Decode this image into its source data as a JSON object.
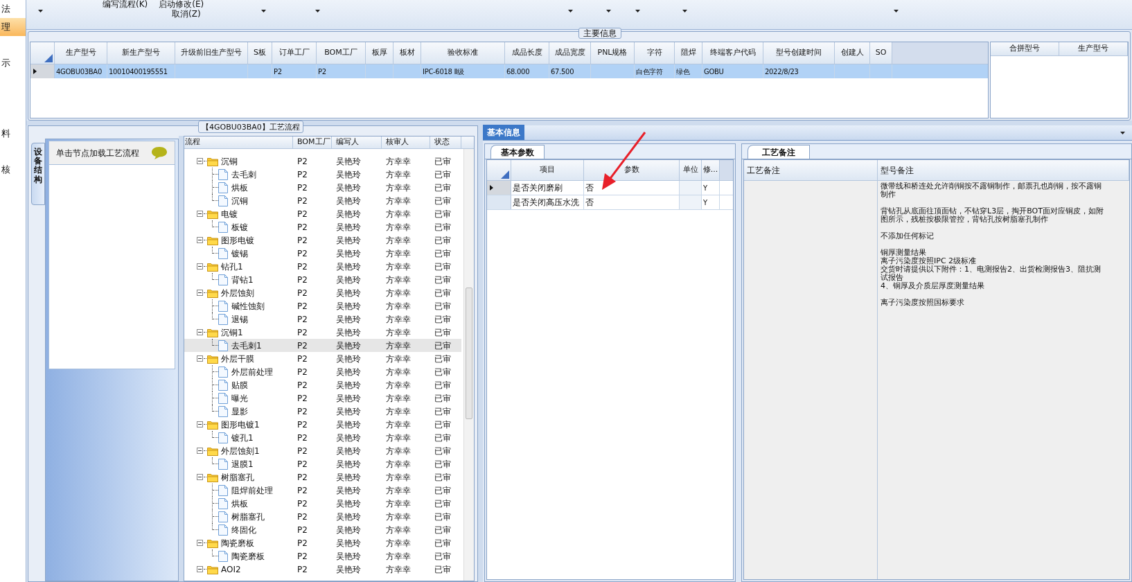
{
  "sidebar": {
    "items": [
      {
        "label": "法",
        "selected": false
      },
      {
        "label": "理",
        "selected": true
      },
      {
        "label": "示",
        "selected": false
      },
      {
        "label": "料",
        "selected": false
      },
      {
        "label": "核",
        "selected": false
      }
    ]
  },
  "ribbon": {
    "commands": [
      "编写流程(K)",
      "启动修改(E)",
      "取消(Z)"
    ]
  },
  "main_info": {
    "title": "主要信息",
    "columns": [
      "生产型号",
      "新生产型号",
      "升级前旧生产型号",
      "S板",
      "订单工厂",
      "BOM工厂",
      "板厚",
      "板材",
      "验收标准",
      "成品长度",
      "成品宽度",
      "PNL规格",
      "字符",
      "阻焊",
      "终端客户代码",
      "型号创建时间",
      "创建人",
      "SO"
    ],
    "rows": [
      {
        "selected": true,
        "cells": [
          "4GOBU03BA0",
          "10010400195551",
          "",
          "",
          "P2",
          "P2",
          "",
          "",
          "IPC-6018 Ⅱ级",
          "68.000",
          "67.500",
          "",
          "白色字符",
          "绿色",
          "GOBU",
          "2022/8/23",
          "",
          ""
        ]
      }
    ],
    "merge_columns": [
      "合拼型号",
      "生产型号"
    ]
  },
  "flow": {
    "title": "【4GOBU03BA0】工艺流程",
    "side_tab": "设备结构",
    "hint": "单击节点加载工艺流程",
    "columns": [
      "流程",
      "BOM工厂",
      "编写人",
      "核审人",
      "状态"
    ],
    "tree": [
      {
        "name": "沉铜",
        "bom": "P2",
        "writer": "吴艳玲",
        "reviewer": "方幸幸",
        "status": "已审",
        "selected": false,
        "expanded": true,
        "children": [
          {
            "name": "去毛刺",
            "bom": "P2",
            "writer": "吴艳玲",
            "reviewer": "方幸幸",
            "status": "已审",
            "selected": false
          },
          {
            "name": "烘板",
            "bom": "P2",
            "writer": "吴艳玲",
            "reviewer": "方幸幸",
            "status": "已审",
            "selected": false
          },
          {
            "name": "沉铜",
            "bom": "P2",
            "writer": "吴艳玲",
            "reviewer": "方幸幸",
            "status": "已审",
            "selected": false
          }
        ]
      },
      {
        "name": "电镀",
        "bom": "P2",
        "writer": "吴艳玲",
        "reviewer": "方幸幸",
        "status": "已审",
        "selected": false,
        "expanded": true,
        "children": [
          {
            "name": "板镀",
            "bom": "P2",
            "writer": "吴艳玲",
            "reviewer": "方幸幸",
            "status": "已审",
            "selected": false
          }
        ]
      },
      {
        "name": "图形电镀",
        "bom": "P2",
        "writer": "吴艳玲",
        "reviewer": "方幸幸",
        "status": "已审",
        "selected": false,
        "expanded": true,
        "children": [
          {
            "name": "镀锡",
            "bom": "P2",
            "writer": "吴艳玲",
            "reviewer": "方幸幸",
            "status": "已审",
            "selected": false
          }
        ]
      },
      {
        "name": "钻孔1",
        "bom": "P2",
        "writer": "吴艳玲",
        "reviewer": "方幸幸",
        "status": "已审",
        "selected": false,
        "expanded": true,
        "children": [
          {
            "name": "背钻1",
            "bom": "P2",
            "writer": "吴艳玲",
            "reviewer": "方幸幸",
            "status": "已审",
            "selected": false
          }
        ]
      },
      {
        "name": "外层蚀刻",
        "bom": "P2",
        "writer": "吴艳玲",
        "reviewer": "方幸幸",
        "status": "已审",
        "selected": false,
        "expanded": true,
        "children": [
          {
            "name": "碱性蚀刻",
            "bom": "P2",
            "writer": "吴艳玲",
            "reviewer": "方幸幸",
            "status": "已审",
            "selected": false
          },
          {
            "name": "退锡",
            "bom": "P2",
            "writer": "吴艳玲",
            "reviewer": "方幸幸",
            "status": "已审",
            "selected": false
          }
        ]
      },
      {
        "name": "沉铜1",
        "bom": "P2",
        "writer": "吴艳玲",
        "reviewer": "方幸幸",
        "status": "已审",
        "selected": false,
        "expanded": true,
        "children": [
          {
            "name": "去毛刺1",
            "bom": "P2",
            "writer": "吴艳玲",
            "reviewer": "方幸幸",
            "status": "已审",
            "selected": true
          }
        ]
      },
      {
        "name": "外层干膜",
        "bom": "P2",
        "writer": "吴艳玲",
        "reviewer": "方幸幸",
        "status": "已审",
        "selected": false,
        "expanded": true,
        "children": [
          {
            "name": "外层前处理",
            "bom": "P2",
            "writer": "吴艳玲",
            "reviewer": "方幸幸",
            "status": "已审",
            "selected": false
          },
          {
            "name": "贴膜",
            "bom": "P2",
            "writer": "吴艳玲",
            "reviewer": "方幸幸",
            "status": "已审",
            "selected": false
          },
          {
            "name": "曝光",
            "bom": "P2",
            "writer": "吴艳玲",
            "reviewer": "方幸幸",
            "status": "已审",
            "selected": false
          },
          {
            "name": "显影",
            "bom": "P2",
            "writer": "吴艳玲",
            "reviewer": "方幸幸",
            "status": "已审",
            "selected": false
          }
        ]
      },
      {
        "name": "图形电镀1",
        "bom": "P2",
        "writer": "吴艳玲",
        "reviewer": "方幸幸",
        "status": "已审",
        "selected": false,
        "expanded": true,
        "children": [
          {
            "name": "镀孔1",
            "bom": "P2",
            "writer": "吴艳玲",
            "reviewer": "方幸幸",
            "status": "已审",
            "selected": false
          }
        ]
      },
      {
        "name": "外层蚀刻1",
        "bom": "P2",
        "writer": "吴艳玲",
        "reviewer": "方幸幸",
        "status": "已审",
        "selected": false,
        "expanded": true,
        "children": [
          {
            "name": "退膜1",
            "bom": "P2",
            "writer": "吴艳玲",
            "reviewer": "方幸幸",
            "status": "已审",
            "selected": false
          }
        ]
      },
      {
        "name": "树脂塞孔",
        "bom": "P2",
        "writer": "吴艳玲",
        "reviewer": "方幸幸",
        "status": "已审",
        "selected": false,
        "expanded": true,
        "children": [
          {
            "name": "阻焊前处理",
            "bom": "P2",
            "writer": "吴艳玲",
            "reviewer": "方幸幸",
            "status": "已审",
            "selected": false
          },
          {
            "name": "烘板",
            "bom": "P2",
            "writer": "吴艳玲",
            "reviewer": "方幸幸",
            "status": "已审",
            "selected": false
          },
          {
            "name": "树脂塞孔",
            "bom": "P2",
            "writer": "吴艳玲",
            "reviewer": "方幸幸",
            "status": "已审",
            "selected": false
          },
          {
            "name": "终固化",
            "bom": "P2",
            "writer": "吴艳玲",
            "reviewer": "方幸幸",
            "status": "已审",
            "selected": false
          }
        ]
      },
      {
        "name": "陶瓷磨板",
        "bom": "P2",
        "writer": "吴艳玲",
        "reviewer": "方幸幸",
        "status": "已审",
        "selected": false,
        "expanded": true,
        "children": [
          {
            "name": "陶瓷磨板",
            "bom": "P2",
            "writer": "吴艳玲",
            "reviewer": "方幸幸",
            "status": "已审",
            "selected": false
          }
        ]
      },
      {
        "name": "AOI2",
        "bom": "P2",
        "writer": "吴艳玲",
        "reviewer": "方幸幸",
        "status": "已审",
        "selected": false,
        "expanded": true
      }
    ]
  },
  "basic_info": {
    "tab": {
      "label": "基本信息",
      "selected": true
    },
    "sub_tab": {
      "label": "基本参数",
      "selected": true
    },
    "columns": [
      "项目",
      "参数",
      "单位",
      "修..."
    ],
    "rows": [
      {
        "selected": true,
        "cells": [
          "是否关闭磨刷",
          "否",
          "",
          "Y"
        ]
      },
      {
        "selected": false,
        "cells": [
          "是否关闭高压水洗",
          "否",
          "",
          "Y"
        ]
      }
    ]
  },
  "process_notes": {
    "sub_tab": {
      "label": "工艺备注",
      "selected": true
    },
    "columns": [
      "工艺备注",
      "型号备注"
    ],
    "model_notes": [
      {
        "lines": [
          "微带线和桥连处允许削铜按不露铜制作，邮票孔也削铜，按不露铜制作"
        ]
      },
      {
        "lines": [
          "背钻孔从底面往顶面钻，不钻穿L3层，掏开BOT面对应铜皮，如附图所示，残桩按极限管控，背钻孔按树脂塞孔制作"
        ]
      },
      {
        "lines": [
          "不添加任何标记"
        ]
      },
      {
        "lines": [
          "铜厚测量结果",
          "离子污染度按照IPC 2级标准",
          "交货时请提供以下附件：1、电测报告2、出货检测报告3、阻抗测试报告",
          "4、铜厚及介质层厚度测量结果"
        ]
      },
      {
        "lines": [
          "离子污染度按照国标要求"
        ]
      }
    ]
  }
}
